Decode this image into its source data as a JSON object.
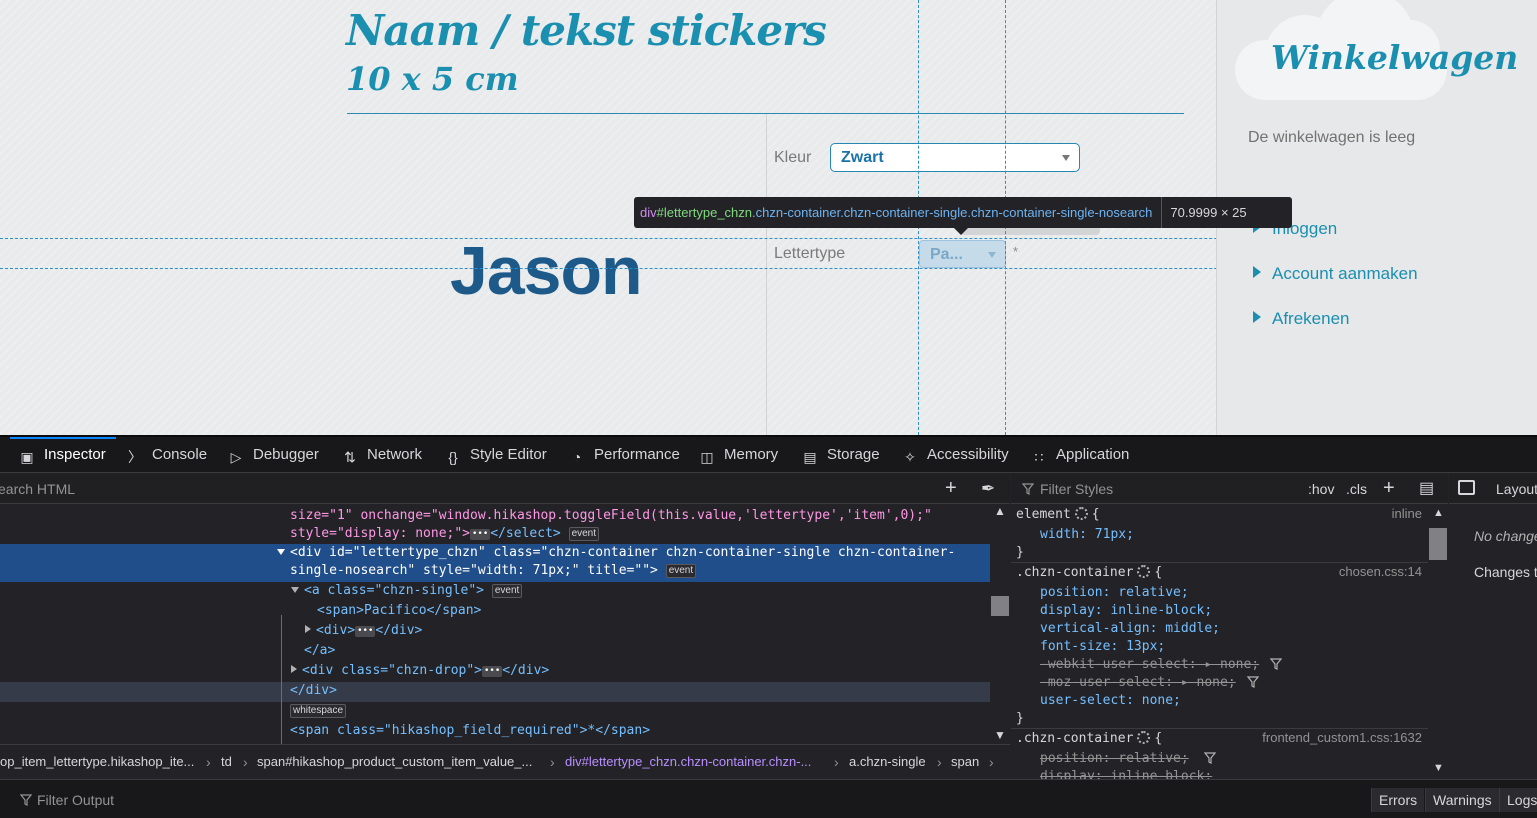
{
  "page": {
    "title_line1": "Naam / tekst stickers",
    "title_line2": "10 x 5 cm",
    "preview_text": "Jason",
    "kleur_label": "Kleur",
    "kleur_value": "Zwart",
    "lettertype_label": "Lettertype",
    "lettertype_value": "Pa...",
    "required_mark": "*",
    "colors": {
      "accent": "#1b8fb0",
      "preview": "#1d5a8a",
      "guide": "#2c8fc9"
    }
  },
  "tooltip": {
    "tag": "div",
    "id": "#lettertype_chzn",
    "classes": ".chzn-container.chzn-container-single.chzn-container-single-nosearch",
    "dims": "70.9999 × 25"
  },
  "sidebar": {
    "cart_title": "Winkelwagen",
    "cart_empty": "De winkelwagen is leeg",
    "links": [
      "Inloggen",
      "Account aanmaken",
      "Afrekenen"
    ]
  },
  "devtools": {
    "tabs": [
      {
        "label": "Inspector",
        "icon": "inspector-icon"
      },
      {
        "label": "Console",
        "icon": "console-icon"
      },
      {
        "label": "Debugger",
        "icon": "debugger-icon"
      },
      {
        "label": "Network",
        "icon": "network-icon"
      },
      {
        "label": "Style Editor",
        "icon": "style-editor-icon"
      },
      {
        "label": "Performance",
        "icon": "performance-icon"
      },
      {
        "label": "Memory",
        "icon": "memory-icon"
      },
      {
        "label": "Storage",
        "icon": "storage-icon"
      },
      {
        "label": "Accessibility",
        "icon": "accessibility-icon"
      },
      {
        "label": "Application",
        "icon": "application-icon"
      }
    ],
    "search_html_placeholder": "earch HTML",
    "markup": {
      "line1": "size=\"1\" onchange=\"window.hikashop.toggleField(this.value,'lettertype','item',0);\"",
      "line2_attr": "style=\"display: none;\">",
      "line2_close": "</select>",
      "sel_line1": "<div id=\"lettertype_chzn\" class=\"chzn-container chzn-container-single chzn-container-",
      "sel_line2": "single-nosearch\" style=\"width: 71px;\" title=\"\">",
      "a_open": "<a class=\"chzn-single\">",
      "span_line": "<span>Pacifico</span>",
      "div_line": "<div>",
      "div_close": "</div>",
      "a_close": "</a>",
      "drop_open": "<div class=\"chzn-drop\">",
      "drop_close": "</div>",
      "close_div": "</div>",
      "span_req": "<span class=\"hikashop_field_required\">*</span>",
      "badge_event": "event",
      "badge_whitespace": "whitespace",
      "ellipsis": "•••"
    },
    "breadcrumbs": [
      "op_item_lettertype.hikashop_ite...",
      "td",
      "span#hikashop_product_custom_item_value_...",
      "div#lettertype_chzn.chzn-container.chzn-...",
      "a.chzn-single",
      "span"
    ],
    "rules": {
      "filter_placeholder": "Filter Styles",
      "hov": ":hov",
      "cls": ".cls",
      "element_selector": "element",
      "element_source": "inline",
      "element_width": "width: 71px;",
      "chzn_selector": ".chzn-container",
      "chzn_source": "chosen.css:14",
      "decls": [
        "position: relative;",
        "display: inline-block;",
        "vertical-align: middle;",
        "font-size: 13px;",
        "-webkit-user-select: ▸ none;",
        "-moz-user-select: ▸ none;",
        "user-select: none;"
      ],
      "chzn2_selector": ".chzn-container",
      "chzn2_source": "frontend_custom1.css:1632",
      "decls2": [
        "position: relative;",
        "display: inline-block;"
      ]
    },
    "layout": {
      "tab": "Layout",
      "no_changes": "No changes",
      "changes_note": "Changes to"
    },
    "console": {
      "filter_placeholder": "Filter Output",
      "buttons": [
        "Errors",
        "Warnings",
        "Logs"
      ]
    }
  }
}
